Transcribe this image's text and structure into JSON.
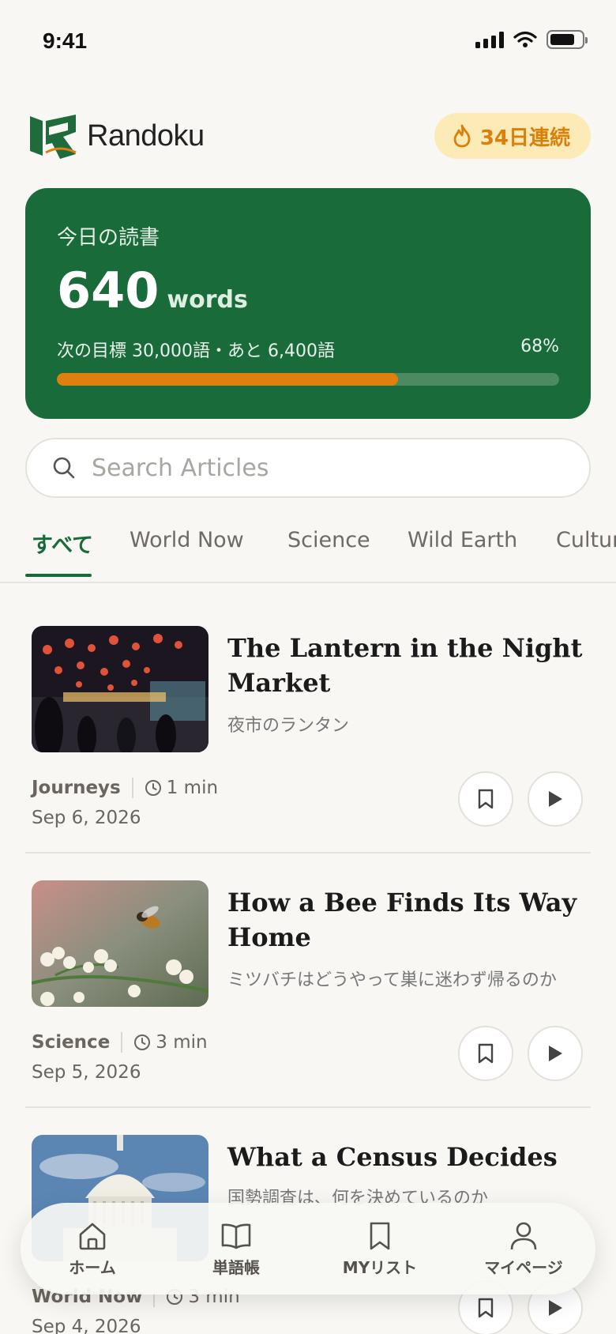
{
  "status_bar": {
    "time": "9:41"
  },
  "header": {
    "brand_name": "Randoku",
    "streak_label": "34日連続"
  },
  "reading_card": {
    "label": "今日の読書",
    "count": "640",
    "unit": "words",
    "goal_text": "次の目標 30,000語・あと 6,400語",
    "percent_text": "68%",
    "progress": 0.68
  },
  "search": {
    "placeholder": "Search Articles"
  },
  "tabs": [
    "すべて",
    "World Now",
    "Science",
    "Wild Earth",
    "Culture"
  ],
  "articles": [
    {
      "title": "The Lantern in the Night Market",
      "subtitle": "夜市のランタン",
      "category": "Journeys",
      "duration": "1 min",
      "date": "Sep 6, 2026"
    },
    {
      "title": "How a Bee Finds Its Way Home",
      "subtitle": "ミツバチはどうやって巣に迷わず帰るのか",
      "category": "Science",
      "duration": "3 min",
      "date": "Sep 5, 2026"
    },
    {
      "title": "What a Census Decides",
      "subtitle": "国勢調査は、何を決めているのか",
      "category": "World Now",
      "duration": "3 min",
      "date": "Sep 4, 2026"
    }
  ],
  "bottom_nav": [
    {
      "label": "ホーム",
      "icon": "home-icon"
    },
    {
      "label": "単語帳",
      "icon": "book-icon"
    },
    {
      "label": "MYリスト",
      "icon": "bookmark-icon"
    },
    {
      "label": "マイページ",
      "icon": "user-icon"
    }
  ],
  "colors": {
    "brand_green": "#1a6b3a",
    "accent_orange": "#e07f0d",
    "streak_bg": "#fcebb6"
  }
}
